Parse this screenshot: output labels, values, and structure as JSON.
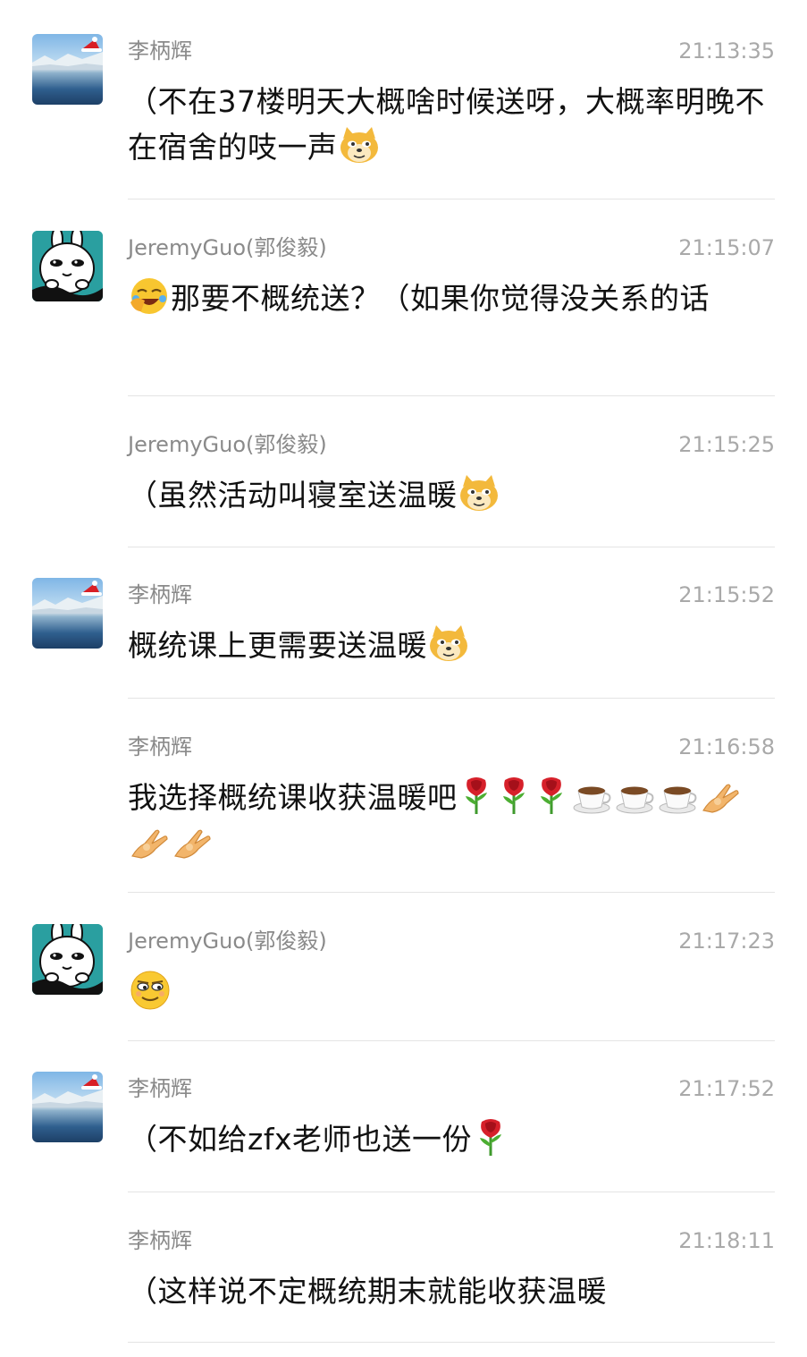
{
  "messages": [
    {
      "sender": "李柄辉",
      "time": "21:13:35",
      "avatar": "lake-avatar",
      "show_avatar": true,
      "segments": [
        {
          "t": "（不在37楼明天大概啥时候送呀，大概率明晚不在宿舍的吱一声"
        },
        {
          "e": "doge-icon"
        }
      ]
    },
    {
      "sender": "JeremyGuo(郭俊毅)",
      "time": "21:15:07",
      "avatar": "bunny-avatar",
      "show_avatar": true,
      "segments": [
        {
          "e": "facepalm-laugh-icon"
        },
        {
          "t": "那要不概统送？（如果你觉得没关系的话"
        }
      ]
    },
    {
      "sender": "JeremyGuo(郭俊毅)",
      "time": "21:15:25",
      "avatar": "bunny-avatar",
      "show_avatar": false,
      "segments": [
        {
          "t": "（虽然活动叫寝室送温暖"
        },
        {
          "e": "doge-icon"
        }
      ]
    },
    {
      "sender": "李柄辉",
      "time": "21:15:52",
      "avatar": "lake-avatar",
      "show_avatar": true,
      "segments": [
        {
          "t": "概统课上更需要送温暖"
        },
        {
          "e": "doge-icon"
        }
      ]
    },
    {
      "sender": "李柄辉",
      "time": "21:16:58",
      "avatar": "lake-avatar",
      "show_avatar": false,
      "segments": [
        {
          "t": "我选择概统课收获温暖吧"
        },
        {
          "e": "rose-icon"
        },
        {
          "e": "rose-icon"
        },
        {
          "e": "rose-icon"
        },
        {
          "e": "coffee-icon"
        },
        {
          "e": "coffee-icon"
        },
        {
          "e": "coffee-icon"
        },
        {
          "e": "ok-hand-icon"
        },
        {
          "e": "ok-hand-icon"
        },
        {
          "e": "ok-hand-icon"
        }
      ]
    },
    {
      "sender": "JeremyGuo(郭俊毅)",
      "time": "21:17:23",
      "avatar": "bunny-avatar",
      "show_avatar": true,
      "segments": [
        {
          "e": "smirk-face-icon"
        }
      ]
    },
    {
      "sender": "李柄辉",
      "time": "21:17:52",
      "avatar": "lake-avatar",
      "show_avatar": true,
      "segments": [
        {
          "t": "（不如给zfx老师也送一份"
        },
        {
          "e": "rose-icon"
        }
      ]
    },
    {
      "sender": "李柄辉",
      "time": "21:18:11",
      "avatar": "lake-avatar",
      "show_avatar": false,
      "segments": [
        {
          "t": "（这样说不定概统期末就能收获温暖"
        }
      ]
    }
  ]
}
